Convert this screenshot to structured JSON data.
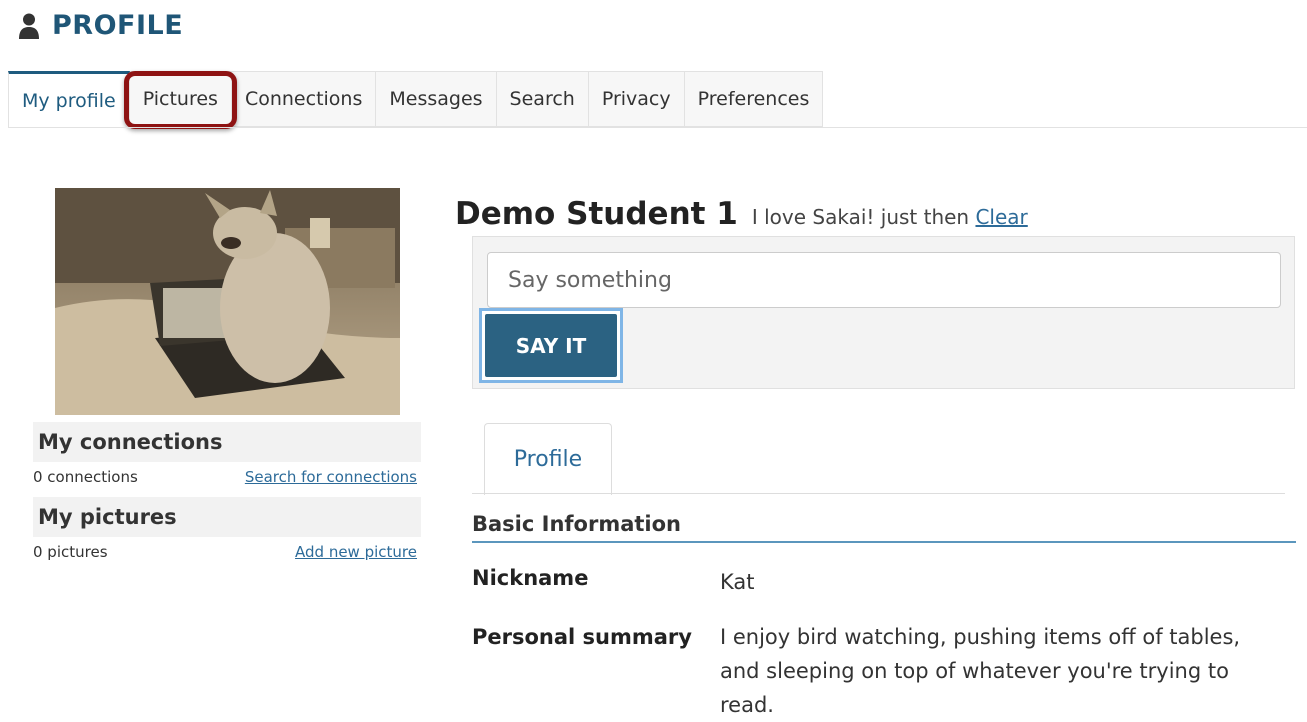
{
  "header": {
    "icon": "person-icon",
    "title": "PROFILE"
  },
  "tabs": [
    {
      "label": "My profile",
      "active": true
    },
    {
      "label": "Pictures",
      "highlighted": true
    },
    {
      "label": "Connections"
    },
    {
      "label": "Messages"
    },
    {
      "label": "Search"
    },
    {
      "label": "Privacy"
    },
    {
      "label": "Preferences"
    }
  ],
  "sidebar": {
    "connections": {
      "title": "My connections",
      "count": "0 connections",
      "link": "Search for connections"
    },
    "pictures": {
      "title": "My pictures",
      "count": "0 pictures",
      "link": "Add new picture"
    }
  },
  "profile": {
    "name": "Demo Student 1",
    "status_text": "I love Sakai! just then",
    "clear_label": "Clear",
    "input_placeholder": "Say something",
    "say_button": "SAY IT",
    "tab_label": "Profile",
    "section_title": "Basic Information",
    "fields": [
      {
        "label": "Nickname",
        "value": "Kat"
      },
      {
        "label": "Personal summary",
        "value": "I enjoy bird watching, pushing items off of tables, and sleeping on top of whatever you're trying to read."
      }
    ]
  },
  "colors": {
    "accent": "#1e5b7f",
    "button": "#2b6282",
    "highlight_ring": "#8e1313",
    "link": "#2d6b99"
  }
}
